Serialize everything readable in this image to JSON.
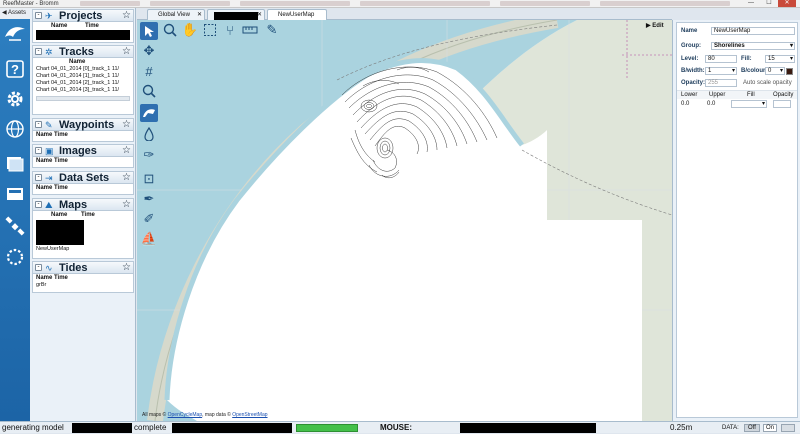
{
  "window": {
    "title": "ReefMaster - Bromm",
    "controls": [
      "—",
      "☐",
      "✕"
    ]
  },
  "rail": {
    "tab_label": "Assets",
    "icons": [
      "reefmaster-logo-icon",
      "help-icon",
      "settings-icon",
      "globe-icon",
      "chart-layers-icon",
      "import-icon",
      "satellite-icon",
      "sync-icon"
    ]
  },
  "assets": {
    "projects": {
      "title": "Projects",
      "col_name": "Name",
      "col_time": "Time"
    },
    "tracks": {
      "title": "Tracks",
      "col_name": "Name",
      "rows": [
        "Chart 04_01_2014 [0]_track_1  11/",
        "Chart 04_01_2014 [1]_track_1  11/",
        "Chart 04_01_2014 [2]_track_1  11/",
        "Chart 04_01_2014 [3]_track_1  11/"
      ]
    },
    "waypoints": {
      "title": "Waypoints",
      "col_name": "Name",
      "col_time": "Time"
    },
    "images": {
      "title": "Images",
      "col_name": "Name",
      "col_time": "Time"
    },
    "datasets": {
      "title": "Data Sets",
      "col_name": "Name",
      "col_time": "Time"
    },
    "maps": {
      "title": "Maps",
      "col_name": "Name",
      "col_time": "Time",
      "item": "NewUserMap"
    },
    "tides": {
      "title": "Tides",
      "col_name": "Name",
      "col_time": "Time",
      "item": "grBr"
    }
  },
  "tabs": [
    {
      "label": "Global View"
    },
    {
      "label": ""
    },
    {
      "label": "NewUserMap"
    }
  ],
  "map": {
    "edit_label": "Edit",
    "attribution_prefix": "All maps © ",
    "attribution_link1": "OpenCycleMap",
    "attribution_mid": ", map data © ",
    "attribution_link2": "OpenStreetMap"
  },
  "props": {
    "name_label": "Name",
    "name_value": "NewUserMap",
    "group_label": "Group:",
    "group_value": "Shorelines",
    "level_label": "Level:",
    "level_value": "80",
    "fill_label": "Fill:",
    "fill_value": "15",
    "bwidth_label": "B/width:",
    "bwidth_value": "1",
    "bcolour_label": "B/colour:",
    "bcolour_value": "0",
    "opacity_label": "Opacity:",
    "opacity_value": "255",
    "auto_scale": "Auto scale opacity",
    "table_headers": [
      "Lower",
      "Upper",
      "Fill",
      "Opacity"
    ],
    "table_row": [
      "0.0",
      "0.0"
    ]
  },
  "status": {
    "generating": "generating model",
    "complete": "complete",
    "mouse_label": "MOUSE:",
    "scale": "0.25m",
    "data_label": "DATA:",
    "off": "Off",
    "on": "On"
  },
  "colors": {
    "water": "#aad3df",
    "land": "#d9e1d3",
    "rail": "#2370b3",
    "accent": "#2f6fb0",
    "progress": "#44c04a"
  }
}
